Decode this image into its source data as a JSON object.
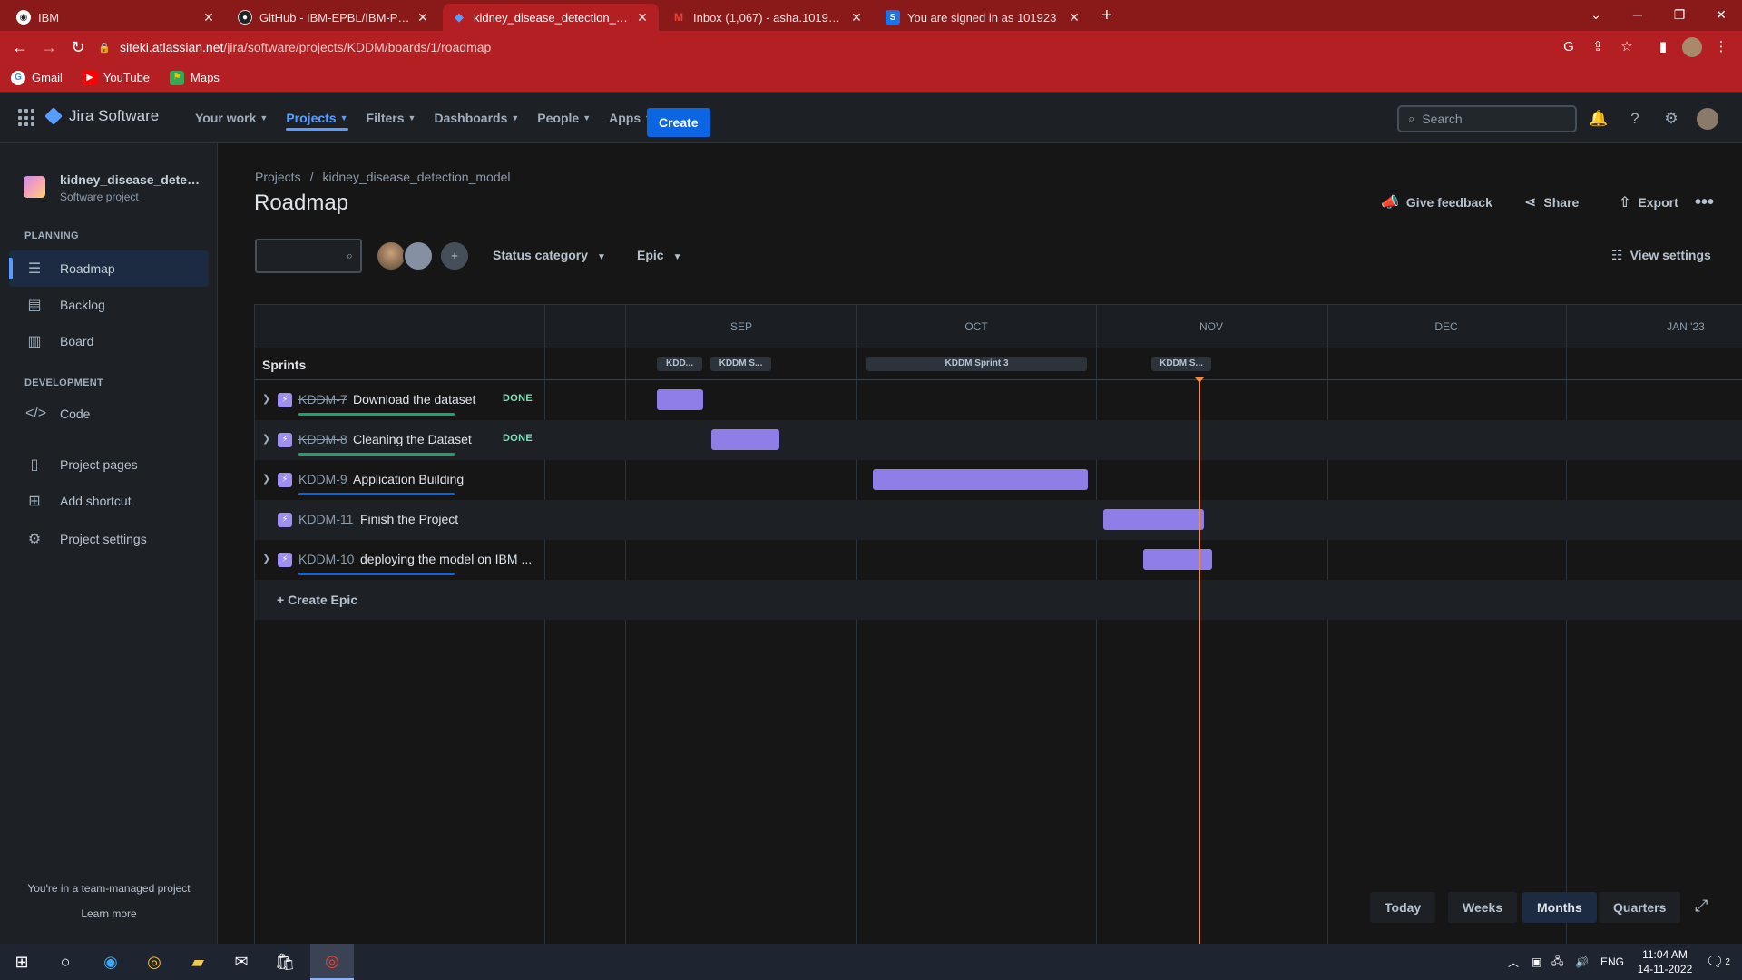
{
  "browser": {
    "tabs": [
      {
        "title": "IBM",
        "favicon": "ibm-icon",
        "active": false
      },
      {
        "title": "GitHub - IBM-EPBL/IBM-Project-",
        "favicon": "github-icon",
        "active": false
      },
      {
        "title": "kidney_disease_detection_model",
        "favicon": "jira-icon",
        "active": true
      },
      {
        "title": "Inbox (1,067) - asha.101923@sx",
        "favicon": "gmail-icon",
        "active": false
      },
      {
        "title": "You are signed in as 101923",
        "favicon": "s-icon",
        "active": false
      }
    ],
    "url_host": "siteki.atlassian.net",
    "url_path": "/jira/software/projects/KDDM/boards/1/roadmap",
    "bookmarks": [
      {
        "label": "Gmail",
        "icon": "google-icon"
      },
      {
        "label": "YouTube",
        "icon": "youtube-icon"
      },
      {
        "label": "Maps",
        "icon": "maps-icon"
      }
    ]
  },
  "jira": {
    "product": "Jira Software",
    "nav": [
      {
        "label": "Your work",
        "active": false
      },
      {
        "label": "Projects",
        "active": true
      },
      {
        "label": "Filters",
        "active": false
      },
      {
        "label": "Dashboards",
        "active": false
      },
      {
        "label": "People",
        "active": false
      },
      {
        "label": "Apps",
        "active": false
      }
    ],
    "create_label": "Create",
    "search_placeholder": "Search"
  },
  "sidebar": {
    "project_name": "kidney_disease_detecti...",
    "project_type": "Software project",
    "planning_heading": "PLANNING",
    "planning_items": [
      {
        "label": "Roadmap",
        "icon": "roadmap-icon",
        "active": true
      },
      {
        "label": "Backlog",
        "icon": "backlog-icon",
        "active": false
      },
      {
        "label": "Board",
        "icon": "board-icon",
        "active": false
      }
    ],
    "development_heading": "DEVELOPMENT",
    "development_items": [
      {
        "label": "Code",
        "icon": "code-icon"
      }
    ],
    "other_items": [
      {
        "label": "Project pages",
        "icon": "pages-icon"
      },
      {
        "label": "Add shortcut",
        "icon": "add-shortcut-icon"
      },
      {
        "label": "Project settings",
        "icon": "settings-icon"
      }
    ],
    "footer_text": "You're in a team-managed project",
    "footer_link": "Learn more"
  },
  "page": {
    "breadcrumb_root": "Projects",
    "breadcrumb_project": "kidney_disease_detection_model",
    "title": "Roadmap",
    "actions": {
      "feedback": "Give feedback",
      "share": "Share",
      "export": "Export"
    },
    "filters": {
      "status_category": "Status category",
      "epic": "Epic",
      "view_settings": "View settings"
    }
  },
  "roadmap": {
    "months": [
      "SEP",
      "OCT",
      "NOV",
      "DEC",
      "JAN '23"
    ],
    "sprints_label": "Sprints",
    "sprints": [
      "KDD...",
      "KDDM S...",
      "KDDM Sprint 3",
      "KDDM S..."
    ],
    "epics": [
      {
        "key": "KDDM-7",
        "title": "Download the dataset",
        "status": "DONE",
        "expandable": true
      },
      {
        "key": "KDDM-8",
        "title": "Cleaning the Dataset",
        "status": "DONE",
        "expandable": true
      },
      {
        "key": "KDDM-9",
        "title": "Application Building",
        "status": "",
        "expandable": true
      },
      {
        "key": "KDDM-11",
        "title": "Finish the Project",
        "status": "",
        "expandable": false
      },
      {
        "key": "KDDM-10",
        "title": "deploying the model on IBM ...",
        "status": "",
        "expandable": true
      }
    ],
    "create_epic": "+ Create Epic",
    "zoom": {
      "today": "Today",
      "weeks": "Weeks",
      "months": "Months",
      "quarters": "Quarters",
      "active": "Months"
    }
  },
  "taskbar": {
    "language": "ENG",
    "time": "11:04 AM",
    "date": "14-11-2022",
    "notifications": "2"
  },
  "colors": {
    "chrome_frame": "#8a1a1a",
    "chrome_active": "#b31f23",
    "jira_blue": "#0c66e4",
    "epic_bar": "#8f7ee7",
    "today_line": "#f38a3f",
    "done_green": "#22a06b"
  }
}
